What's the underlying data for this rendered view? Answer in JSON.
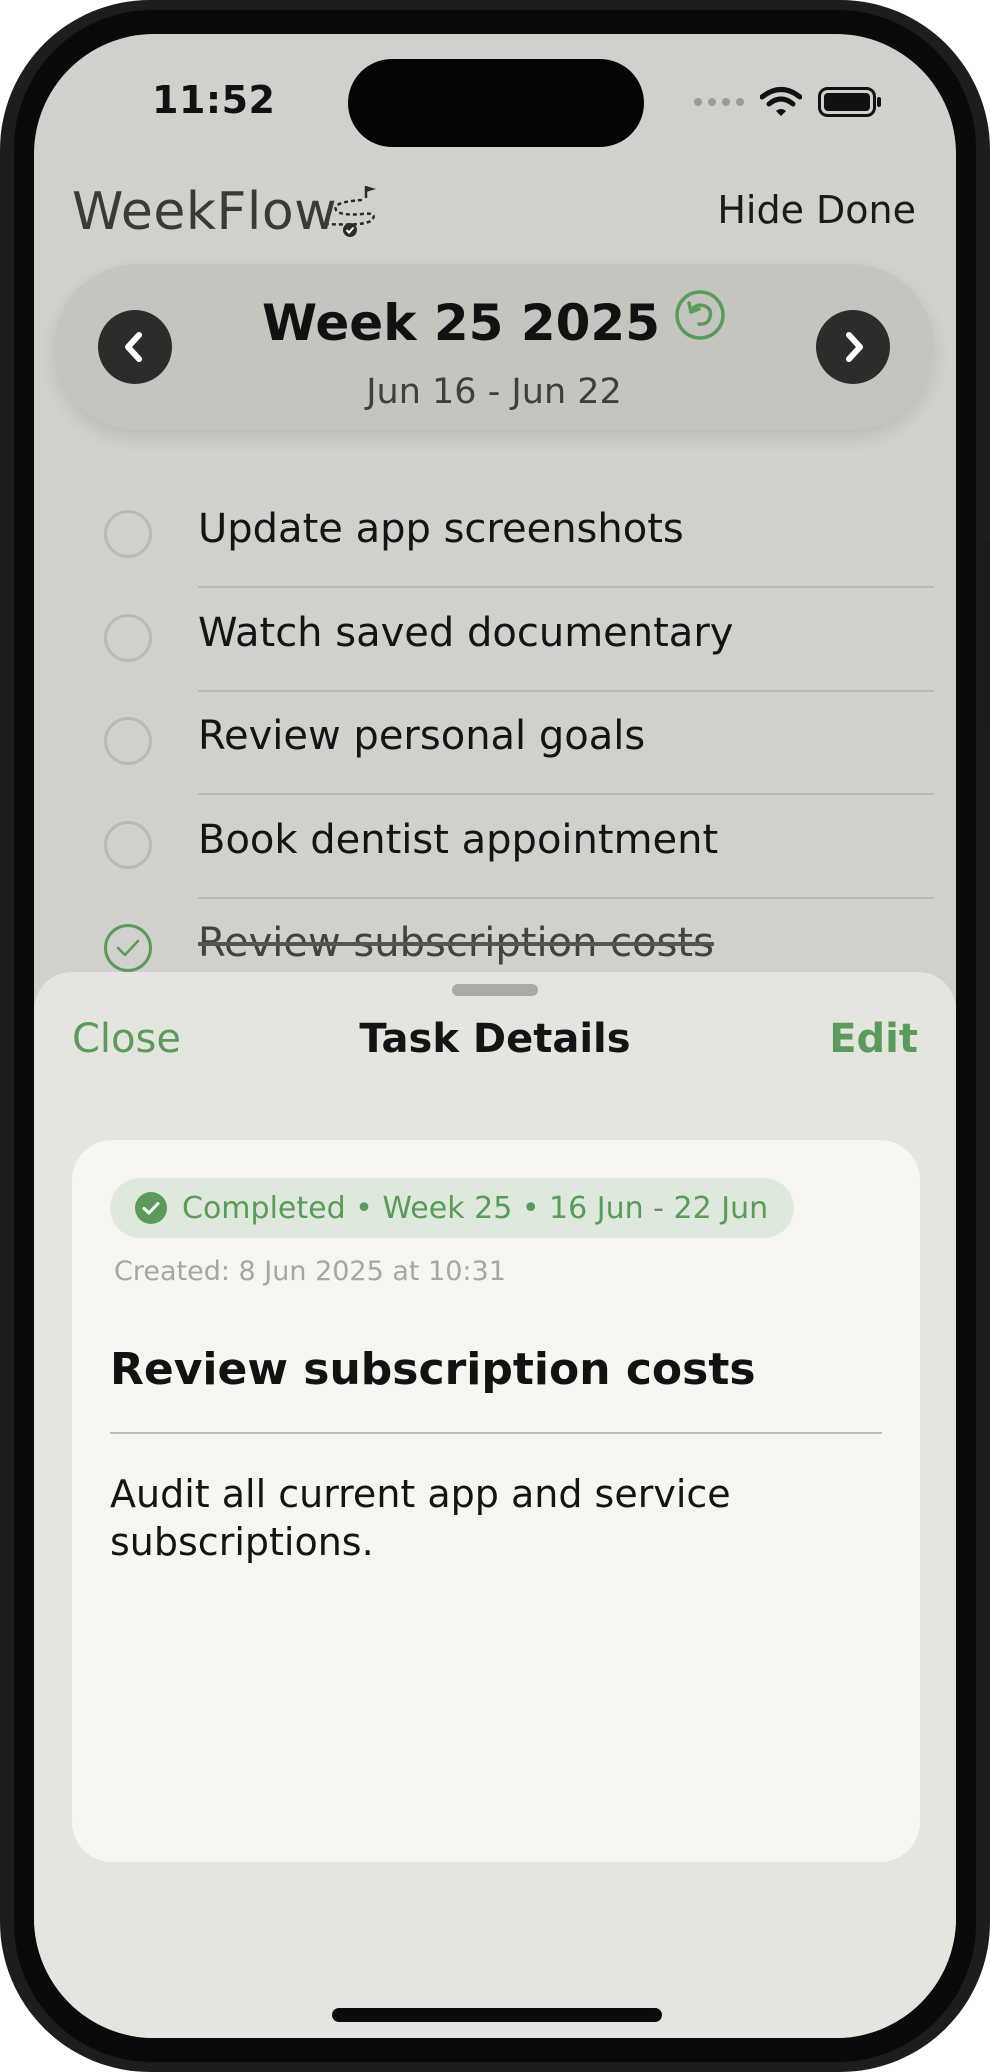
{
  "status_bar": {
    "time": "11:52"
  },
  "header": {
    "app_title": "WeekFlow",
    "hide_done_label": "Hide Done"
  },
  "week": {
    "title": "Week 25 2025",
    "range": "Jun 16 - Jun 22"
  },
  "tasks": [
    {
      "label": "Update app screenshots",
      "done": false
    },
    {
      "label": "Watch saved documentary",
      "done": false
    },
    {
      "label": "Review personal goals",
      "done": false
    },
    {
      "label": "Book dentist appointment",
      "done": false
    },
    {
      "label": "Review subscription costs",
      "done": true
    }
  ],
  "sheet": {
    "close_label": "Close",
    "title": "Task Details",
    "edit_label": "Edit",
    "status_badge": "Completed • Week 25 • 16 Jun - 22 Jun",
    "created": "Created: 8 Jun 2025 at 10:31",
    "task_title": "Review subscription costs",
    "notes": "Audit all current app and service subscriptions."
  },
  "colors": {
    "accent": "#5a9a5a",
    "background": "#d0d0cc",
    "sheet": "#e5e5df",
    "card": "#f6f6f1"
  },
  "icons": [
    "chevron-left-icon",
    "chevron-right-icon",
    "reset-week-icon",
    "checkmark-icon",
    "wifi-icon",
    "battery-icon",
    "signal-icon",
    "logo-path-icon"
  ]
}
